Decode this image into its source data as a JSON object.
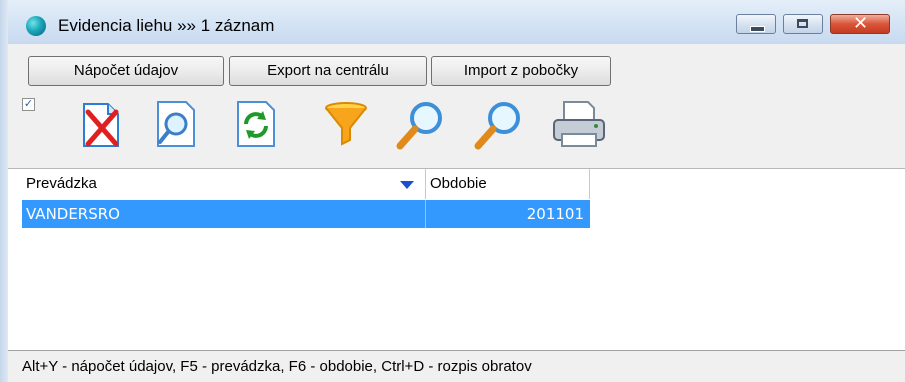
{
  "window": {
    "title": "Evidencia liehu »» 1 záznam",
    "controls": {
      "minimize_icon": "minimize-icon",
      "maximize_icon": "maximize-icon",
      "close_icon": "close-icon"
    }
  },
  "actions": {
    "compute_label": "Nápočet údajov",
    "export_label": "Export na centrálu",
    "import_label": "Import z pobočky"
  },
  "toolbar": {
    "checkbox_checked": true,
    "icons": [
      "delete-icon",
      "preview-icon",
      "refresh-icon",
      "filter-icon",
      "search-icon",
      "search-next-icon",
      "print-icon"
    ]
  },
  "grid": {
    "columns": [
      {
        "label": "Prevádzka",
        "sorted": "desc"
      },
      {
        "label": "Obdobie"
      }
    ],
    "rows": [
      {
        "prevadzka": "VANDERSRO",
        "obdobie": "201101",
        "selected": true
      }
    ],
    "colors": {
      "selection": "#3399ff",
      "sort_arrow": "#1b4fd0"
    }
  },
  "status": {
    "text": "Alt+Y - nápočet údajov, F5 - prevádzka, F6 - obdobie, Ctrl+D - rozpis obratov"
  }
}
